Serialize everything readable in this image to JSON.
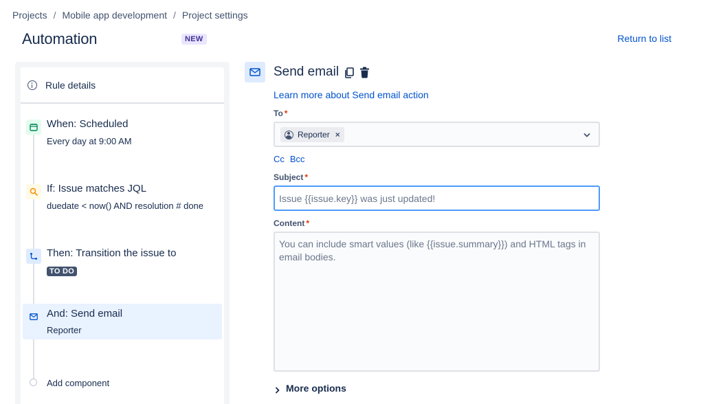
{
  "breadcrumb": {
    "items": [
      "Projects",
      "Mobile app development",
      "Project settings"
    ],
    "separator": "/"
  },
  "header": {
    "title": "Automation",
    "badge": "NEW",
    "return_link": "Return to list"
  },
  "rule": {
    "details_label": "Rule details",
    "steps": {
      "when": {
        "title": "When: Scheduled",
        "subtitle": "Every day at 9:00 AM",
        "icon": "calendar-icon"
      },
      "if": {
        "title": "If: Issue matches JQL",
        "subtitle": "duedate < now() AND resolution # done",
        "icon": "search-icon"
      },
      "then": {
        "title": "Then: Transition the issue to",
        "status": "TO DO",
        "icon": "transition-icon"
      },
      "and": {
        "title": "And: Send email",
        "subtitle": "Reporter",
        "icon": "mail-icon"
      }
    },
    "add_component": "Add component"
  },
  "action": {
    "title": "Send email",
    "learn_more": "Learn more about Send email action",
    "to": {
      "label": "To",
      "required": "*",
      "chip": "Reporter",
      "remove": "×"
    },
    "cc": "Cc",
    "bcc": "Bcc",
    "subject": {
      "label": "Subject",
      "required": "*",
      "placeholder": "Issue {{issue.key}} was just updated!"
    },
    "content": {
      "label": "Content",
      "required": "*",
      "placeholder": "You can include smart values (like {{issue.summary}}) and HTML tags in email bodies."
    },
    "more_options": "More options"
  },
  "colors": {
    "link": "#0052cc",
    "text": "#172b4d",
    "focus": "#4c9aff",
    "badge_bg": "#eae6ff",
    "selected_step": "#e9f2ff"
  }
}
